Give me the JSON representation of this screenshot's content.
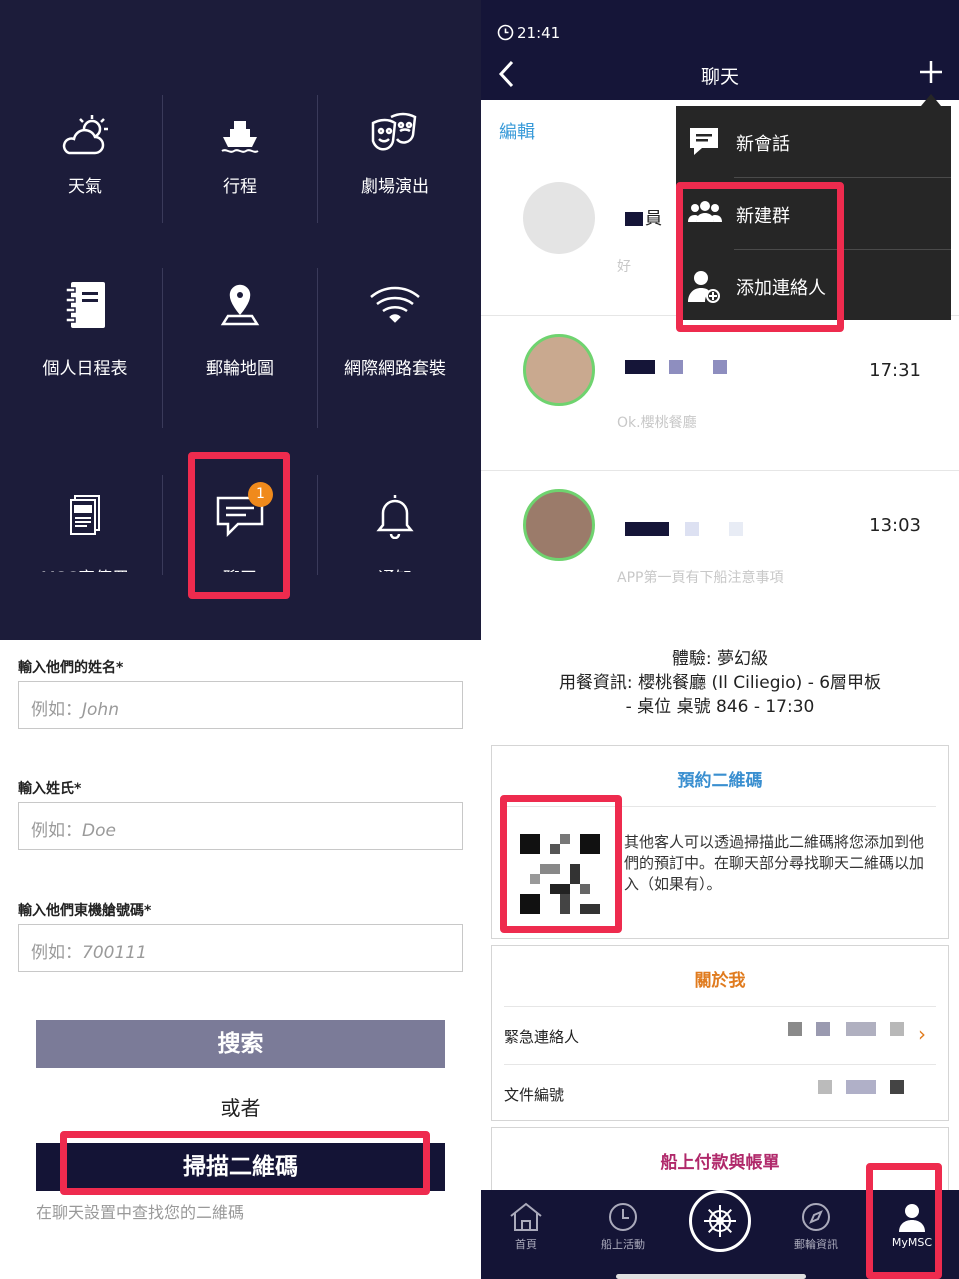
{
  "menu": {
    "tiles": [
      {
        "label": "天氣",
        "icon": "weather-icon"
      },
      {
        "label": "行程",
        "icon": "ship-icon"
      },
      {
        "label": "劇場演出",
        "icon": "theater-masks-icon"
      },
      {
        "label": "個人日程表",
        "icon": "notebook-icon"
      },
      {
        "label": "郵輪地圖",
        "icon": "map-pin-icon"
      },
      {
        "label": "網際網路套裝",
        "icon": "wifi-icon"
      },
      {
        "label": "MSC宣傳冊",
        "icon": "brochure-icon"
      },
      {
        "label": "聊天",
        "icon": "chat-icon",
        "badge": "1"
      },
      {
        "label": "通知",
        "icon": "bell-icon"
      }
    ],
    "colors": {
      "background": "#1c1c3a",
      "badge": "#f08a1c",
      "highlight": "#ee2b4e"
    }
  },
  "form": {
    "first_name_label": "輸入他們的姓名*",
    "first_name_prefix": "例如：",
    "first_name_placeholder": "John",
    "last_name_label": "輸入姓氏*",
    "last_name_prefix": "例如：",
    "last_name_placeholder": "Doe",
    "cabin_label": "輸入他們東機艙號碼*",
    "cabin_prefix": "例如：",
    "cabin_placeholder": "700111",
    "search_button": "搜索",
    "or_text": "或者",
    "scan_button": "掃描二維碼",
    "hint": "在聊天設置中查找您的二維碼"
  },
  "chat": {
    "time": "21:41",
    "title": "聊天",
    "edit": "編輯",
    "conversations": [
      {
        "name_fragment": "員",
        "preview": "好",
        "time": ""
      },
      {
        "name_fragment": "",
        "preview": "Ok.櫻桃餐廳",
        "time": "17:31"
      },
      {
        "name_fragment": "",
        "preview": "APP第一頁有下船注意事項",
        "time": "13:03"
      }
    ],
    "dropdown": [
      {
        "label": "新會話",
        "icon": "new-chat-icon"
      },
      {
        "label": "新建群",
        "icon": "group-icon"
      },
      {
        "label": "添加連絡人",
        "icon": "add-contact-icon"
      }
    ]
  },
  "mymsc": {
    "experience": "體驗: 夢幻級",
    "dining_line1": "用餐資訊: 櫻桃餐廳 (Il Ciliegio) - 6層甲板",
    "dining_line2": "- 桌位 桌號 846 - 17:30",
    "qr_card": {
      "title": "預約二維碼",
      "text": "其他客人可以透過掃描此二維碼將您添加到他們的預訂中。在聊天部分尋找聊天二維碼以加入（如果有）。"
    },
    "about_card": {
      "title": "關於我",
      "emergency_label": "緊急連絡人",
      "doc_label": "文件編號"
    },
    "payment_card": {
      "title": "船上付款與帳單"
    },
    "tabs": [
      {
        "label": "首頁",
        "icon": "home-icon"
      },
      {
        "label": "船上活動",
        "icon": "clock-icon"
      },
      {
        "label": "",
        "icon": "ship-wheel-icon"
      },
      {
        "label": "郵輪資訊",
        "icon": "compass-icon"
      },
      {
        "label": "MyMSC",
        "icon": "user-icon"
      }
    ],
    "colors": {
      "title_blue": "#3a8fd0",
      "title_orange": "#e07b1e",
      "title_magenta": "#b0286a",
      "tabbar": "#141436"
    }
  }
}
